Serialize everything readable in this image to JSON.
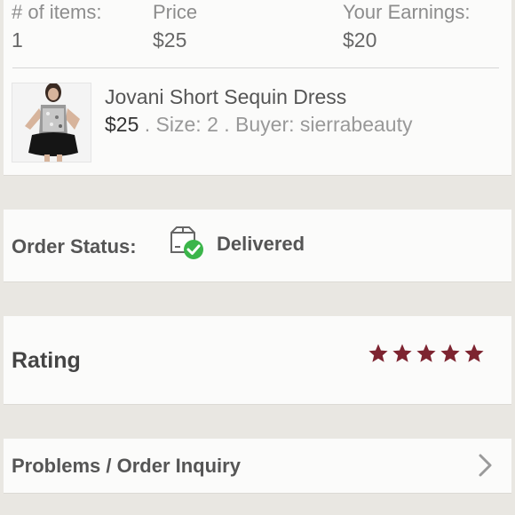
{
  "summary": {
    "items_label": "# of items:",
    "items_value": "1",
    "price_label": "Price",
    "price_value": "$25",
    "earnings_label": "Your Earnings:",
    "earnings_value": "$20"
  },
  "item": {
    "title": "Jovani Short Sequin Dress",
    "price": "$25",
    "size": " . Size: 2",
    "buyer": " . Buyer: sierrabeauty"
  },
  "order_status": {
    "label": "Order Status:",
    "value": "Delivered",
    "icon": "delivered-box-check-icon",
    "check_color": "#3bb54a"
  },
  "rating": {
    "label": "Rating",
    "stars": 5,
    "star_color": "#7d2430"
  },
  "problems": {
    "label": "Problems / Order Inquiry"
  }
}
